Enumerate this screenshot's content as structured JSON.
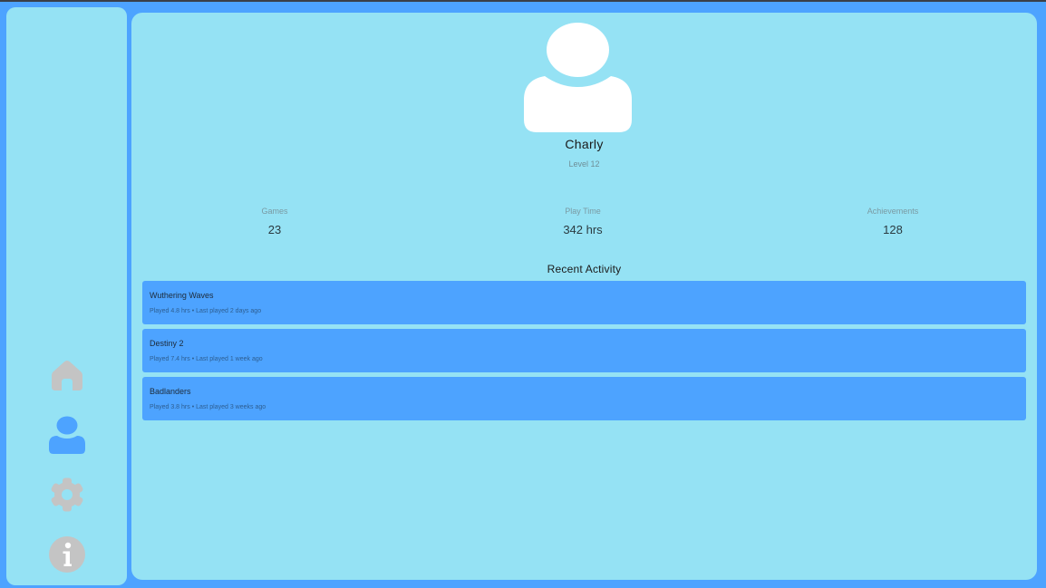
{
  "sidebar": {
    "items": [
      {
        "icon": "home-icon",
        "active": false,
        "color": "#c4c4c4"
      },
      {
        "icon": "user-icon",
        "active": true,
        "color": "#4da3ff"
      },
      {
        "icon": "gear-icon",
        "active": false,
        "color": "#c4c4c4"
      },
      {
        "icon": "info-icon",
        "active": false,
        "color": "#c4c4c4"
      }
    ]
  },
  "profile": {
    "name": "Charly",
    "level": "Level 12"
  },
  "stats": {
    "games": {
      "label": "Games",
      "value": "23"
    },
    "play_time": {
      "label": "Play Time",
      "value": "342 hrs"
    },
    "achievements": {
      "label": "Achievements",
      "value": "128"
    }
  },
  "recent_activity": {
    "title": "Recent Activity",
    "items": [
      {
        "game": "Wuthering Waves",
        "meta": "Played 4.8 hrs • Last played 2 days ago"
      },
      {
        "game": "Destiny 2",
        "meta": "Played 7.4 hrs • Last played 1 week ago"
      },
      {
        "game": "Badlanders",
        "meta": "Played 3.8 hrs • Last played 3 weeks ago"
      }
    ]
  },
  "colors": {
    "background": "#4da3ff",
    "panel": "#95e2f4",
    "accent": "#4da3ff",
    "inactive_icon": "#c4c4c4"
  }
}
